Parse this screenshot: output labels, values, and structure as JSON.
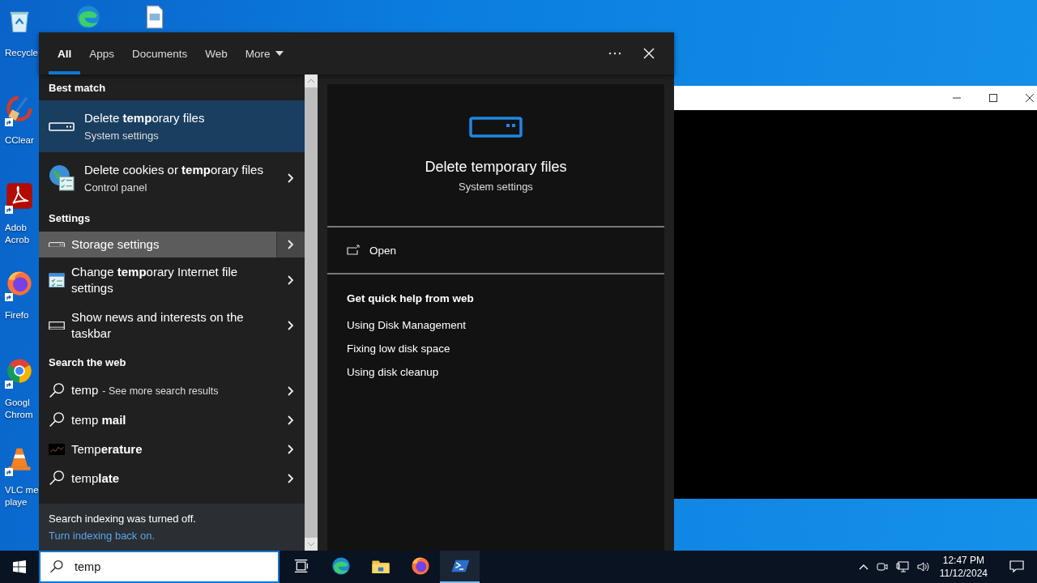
{
  "desktop_icons": [
    {
      "kind": "recycle-bin",
      "lines": [
        "Recycle"
      ],
      "shortcut": false
    },
    {
      "kind": "broom",
      "lines": [
        "CClear"
      ],
      "shortcut": true
    },
    {
      "kind": "pdf",
      "lines": [
        "Adob",
        "Acrob"
      ],
      "shortcut": true
    },
    {
      "kind": "firefox",
      "lines": [
        "Firefo"
      ],
      "shortcut": true
    },
    {
      "kind": "chrome",
      "lines": [
        "Googl",
        "Chrom"
      ],
      "shortcut": true
    },
    {
      "kind": "cone",
      "lines": [
        "VLC me",
        "playe"
      ],
      "shortcut": true
    }
  ],
  "top_icons": [
    {
      "kind": "edge"
    },
    {
      "kind": "document"
    }
  ],
  "search_panel": {
    "tabs": [
      {
        "label": "All",
        "selected": true,
        "dropdown": false
      },
      {
        "label": "Apps",
        "selected": false,
        "dropdown": false
      },
      {
        "label": "Documents",
        "selected": false,
        "dropdown": false
      },
      {
        "label": "Web",
        "selected": false,
        "dropdown": false
      },
      {
        "label": "More",
        "selected": false,
        "dropdown": true
      }
    ],
    "sections": [
      {
        "heading": "Best match",
        "items": [
          {
            "kind": "drive",
            "title": "Delete **temp**orary files",
            "subtitle": "System settings",
            "selected": true,
            "hovered": false,
            "arrow": false
          },
          {
            "kind": "globe",
            "title": "Delete cookies or **temp**orary files",
            "subtitle": "Control panel",
            "selected": false,
            "hovered": false,
            "arrow": true
          }
        ]
      },
      {
        "heading": "Settings",
        "items": [
          {
            "kind": "drive",
            "title": "Storage settings",
            "selected": false,
            "hovered": true,
            "arrow": true
          },
          {
            "kind": "checklist",
            "title": "Change **temp**orary Internet file settings",
            "selected": false,
            "hovered": false,
            "arrow": true
          },
          {
            "kind": "monitor",
            "title": "Show news and interests on the taskbar",
            "selected": false,
            "hovered": false,
            "arrow": true
          }
        ]
      },
      {
        "heading": "Search the web",
        "items": [
          {
            "kind": "search",
            "title": "temp",
            "note": "- See more search results",
            "selected": false,
            "hovered": false,
            "arrow": true
          },
          {
            "kind": "search",
            "title": "temp **mail**",
            "selected": false,
            "hovered": false,
            "arrow": true
          },
          {
            "kind": "chart",
            "title": "Temp**erature**",
            "selected": false,
            "hovered": false,
            "arrow": true
          },
          {
            "kind": "search",
            "title": "temp**late**",
            "selected": false,
            "hovered": false,
            "arrow": true
          }
        ]
      }
    ],
    "notice": {
      "text": "Search indexing was turned off.",
      "link": "Turn indexing back on."
    },
    "preview": {
      "title": "Delete temporary files",
      "subtitle": "System settings",
      "actions": [
        {
          "label": "Open"
        }
      ],
      "help_heading": "Get quick help from web",
      "help_links": [
        "Using Disk Management",
        "Fixing low disk space",
        "Using disk cleanup"
      ]
    }
  },
  "taskbar": {
    "search": {
      "value": "temp"
    },
    "apps": [
      {
        "kind": "task-view",
        "active": false
      },
      {
        "kind": "edge",
        "active": false
      },
      {
        "kind": "folder",
        "active": false
      },
      {
        "kind": "firefox",
        "active": false
      },
      {
        "kind": "powershell",
        "active": true
      }
    ],
    "clock": {
      "time": "12:47 PM",
      "date": "11/12/2024"
    }
  }
}
